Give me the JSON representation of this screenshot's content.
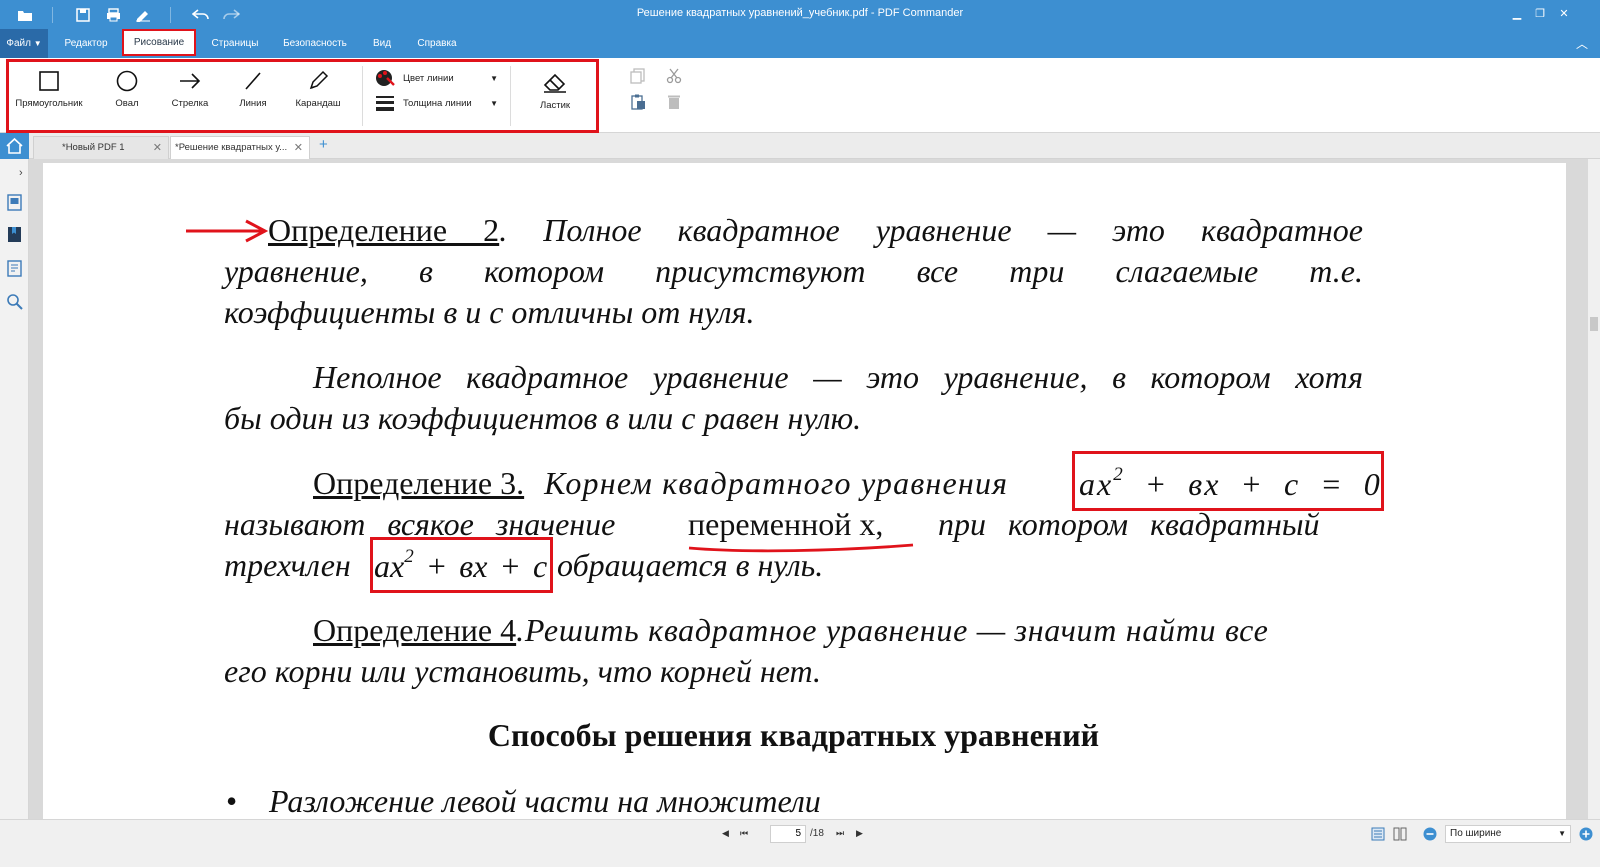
{
  "window": {
    "title": "Решение квадратных уравнений_учебник.pdf - PDF Commander"
  },
  "menu": {
    "file": "Файл",
    "items": [
      "Редактор",
      "Рисование",
      "Страницы",
      "Безопасность",
      "Вид",
      "Справка"
    ],
    "active": "Рисование"
  },
  "ribbon": {
    "tools": [
      "Прямоугольник",
      "Овал",
      "Стрелка",
      "Линия",
      "Карандаш"
    ],
    "line_color": "Цвет линии",
    "line_width": "Толщина линии",
    "eraser": "Ластик"
  },
  "tabs": [
    "*Новый PDF 1",
    "*Решение квадратных у..."
  ],
  "document": {
    "p1_label": "Определение 2",
    "p1_text_a": ". Полное квадратное уравнение — это квадратное",
    "p1_line2": "уравнение, в котором присутствуют все три слагаемые т.е.",
    "p1_line3": "коэффициенты в и с отличны от нуля.",
    "p2_line1": "Неполное квадратное уравнение — это уравнение, в котором хотя",
    "p2_line2": "бы один из коэффициентов в или с равен нулю.",
    "p3_label": "Определение 3.",
    "p3_text_a": "Корнем квадратного уравнения",
    "p3_eq_a": "ах",
    "p3_eq_sup": "2",
    "p3_eq_b": " + вх + с = 0",
    "p3_line2_a": "называют всякое значение",
    "p3_line2_b": "переменной х,",
    "p3_line2_c": "при котором квадратный",
    "p3_line3_a": "трехчлен",
    "p3_expr_a": "ах",
    "p3_expr_sup": "2",
    "p3_expr_b": " + вх + с",
    "p3_line3_b": "обращается в нуль.",
    "p4_label": "Определение 4",
    "p4_text_a": ".Решить квадратное уравнение — значит найти все",
    "p4_line2": "его корни или установить, что корней нет.",
    "heading": "Способы решения квадратных уравнений",
    "bullet": "•",
    "bullet_item": "Разложение левой части на множители"
  },
  "status": {
    "page_current": "5",
    "page_total": "/18",
    "zoom": "По ширине"
  },
  "colors": {
    "accent": "#3d8fd1",
    "annotation": "#e0131b"
  }
}
